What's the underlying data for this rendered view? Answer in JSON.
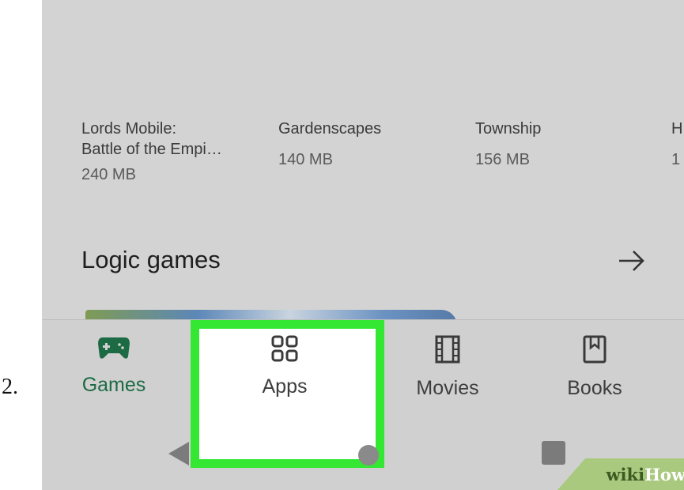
{
  "step_number": "2.",
  "games": [
    {
      "title_line1": "Lords Mobile:",
      "title_line2": "Battle of the Empi…",
      "size": "240 MB"
    },
    {
      "title_line1": "Gardenscapes",
      "title_line2": "",
      "size": "140 MB"
    },
    {
      "title_line1": "Township",
      "title_line2": "",
      "size": "156 MB"
    },
    {
      "title_line1": "H",
      "title_line2": "",
      "size": "1"
    }
  ],
  "section": {
    "title": "Logic games"
  },
  "bottom_nav": {
    "items": [
      {
        "label": "Games",
        "icon": "gamepad-icon",
        "active": true
      },
      {
        "label": "Apps",
        "icon": "apps-grid-icon",
        "active": false
      },
      {
        "label": "Movies",
        "icon": "film-icon",
        "active": false
      },
      {
        "label": "Books",
        "icon": "bookmark-book-icon",
        "active": false
      }
    ]
  },
  "colors": {
    "active": "#1d6b45",
    "highlight": "#33e733",
    "background": "#d3d3d3"
  },
  "watermark": {
    "part1": "wiki",
    "part2": "How"
  }
}
